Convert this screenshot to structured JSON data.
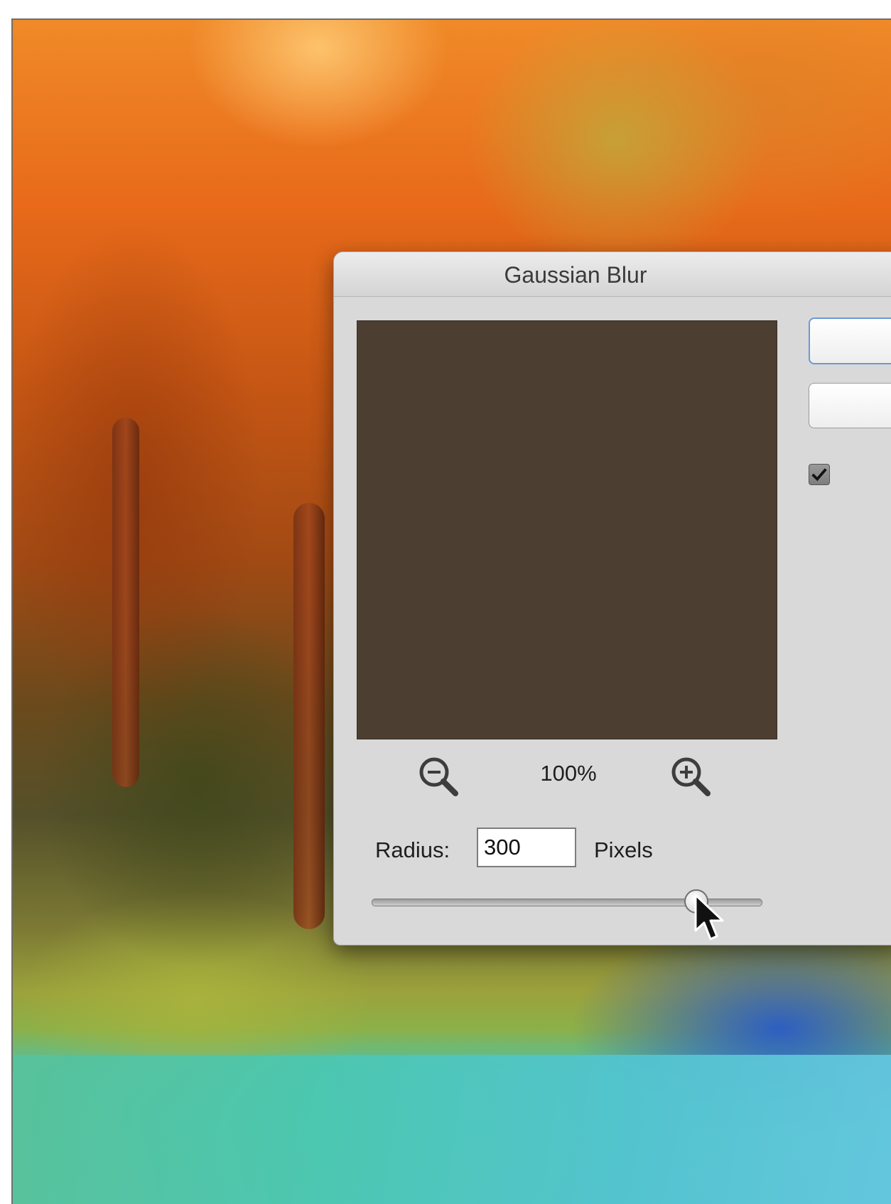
{
  "dialog": {
    "title": "Gaussian Blur",
    "zoom_level": "100%",
    "radius_label": "Radius:",
    "radius_value": "300",
    "units_label": "Pixels",
    "preview_checked": true,
    "radius_slider_position": 0.83
  },
  "icons": {
    "zoom_out": "zoom-out-magnifier-icon",
    "zoom_in": "zoom-in-magnifier-icon",
    "pointer": "mouse-pointer-icon"
  },
  "colors": {
    "preview_fill": "#4c3f31",
    "dialog_bg": "#d9d9d9",
    "default_button_border": "#6a9ad8"
  }
}
